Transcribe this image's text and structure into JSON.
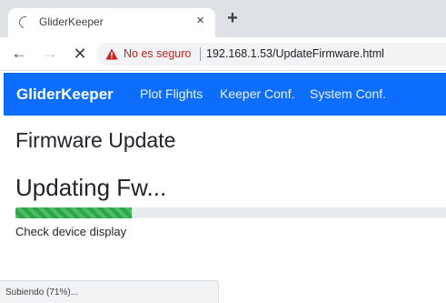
{
  "browser": {
    "tab": {
      "title": "GliderKeeper",
      "close_glyph": "×"
    },
    "new_tab_glyph": "+",
    "toolbar": {
      "back_glyph": "←",
      "forward_glyph": "→",
      "stop_glyph": "✕",
      "security_label": "No es seguro",
      "url": "192.168.1.53/UpdateFirmware.html",
      "warning_color": "#c5221f"
    },
    "status_text": "Subiendo (71%)..."
  },
  "site": {
    "brand": "GliderKeeper",
    "nav_links": [
      "Plot Flights",
      "Keeper Conf.",
      "System Conf."
    ],
    "navbar_color": "#0d6efd"
  },
  "content": {
    "page_title": "Firmware Update",
    "status_heading": "Updating Fw...",
    "progress_fraction": 0.27,
    "progress_color": "#28a745",
    "hint": "Check device display"
  },
  "icons": {
    "tab_loading": "loading-spinner-icon",
    "security": "warning-triangle-icon"
  }
}
